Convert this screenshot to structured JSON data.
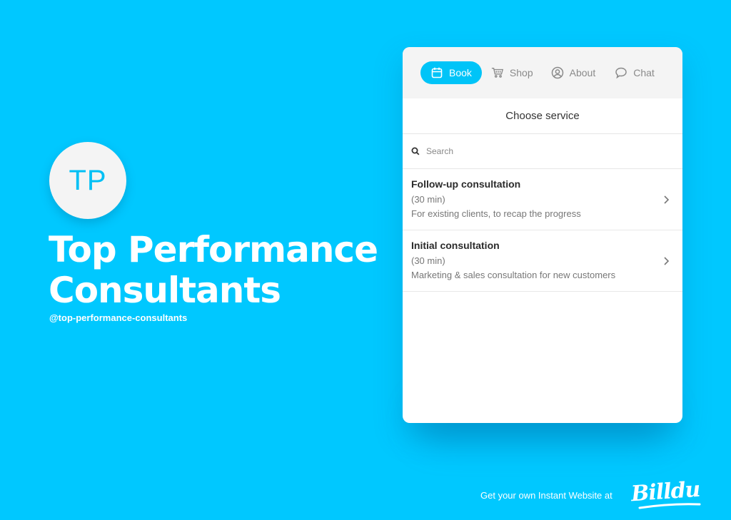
{
  "brand": {
    "initials": "TP",
    "name": "Top Performance Consultants",
    "handle": "@top-performance-consultants"
  },
  "colors": {
    "background": "#00c8ff",
    "accent": "#00c4f8",
    "tab_bar": "#f4f4f4"
  },
  "widget": {
    "tabs": [
      {
        "label": "Book",
        "icon": "calendar-icon",
        "active": true
      },
      {
        "label": "Shop",
        "icon": "cart-icon",
        "active": false
      },
      {
        "label": "About",
        "icon": "user-circle-icon",
        "active": false
      },
      {
        "label": "Chat",
        "icon": "chat-bubble-icon",
        "active": false
      }
    ],
    "section_title": "Choose service",
    "search": {
      "placeholder": "Search",
      "value": ""
    },
    "services": [
      {
        "name": "Follow-up consultation",
        "duration": "(30 min)",
        "description": "For existing clients, to recap the progress"
      },
      {
        "name": "Initial consultation",
        "duration": "(30 min)",
        "description": "Marketing & sales consultation for new customers"
      }
    ]
  },
  "footer": {
    "text": "Get your own Instant Website at",
    "logo": "Billdu"
  }
}
